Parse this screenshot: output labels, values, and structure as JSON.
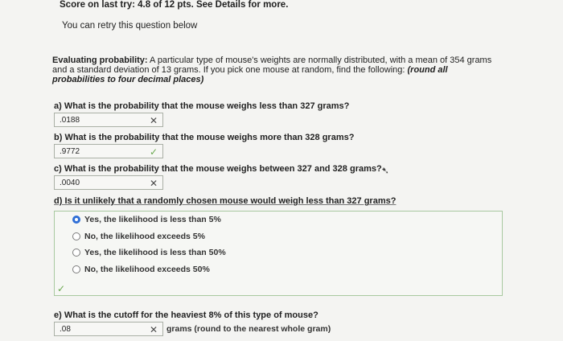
{
  "header": {
    "score_line": "Score on last try: 4.8 of 12 pts. See Details for more.",
    "retry_line": "You can retry this question below"
  },
  "problem": {
    "label": "Evaluating probability:",
    "text": "A particular type of mouse's weights are normally distributed, with a mean of 354 grams and a standard deviation of 13 grams. If you pick one mouse at random, find the following:",
    "instruction": "(round all probabilities to four decimal places)"
  },
  "questions": {
    "a": {
      "text": "a) What is the probability that the mouse weighs less than 327 grams?",
      "value": ".0188",
      "status": "incorrect"
    },
    "b": {
      "text": "b) What is the probability that the mouse weighs more than 328 grams?",
      "value": ".9772",
      "status": "correct"
    },
    "c": {
      "text": "c) What is the probability that the mouse weighs between 327 and 328 grams?",
      "value": ".0040",
      "status": "incorrect"
    },
    "d": {
      "text": "d) Is it unlikely that a randomly chosen mouse would weigh less than 327 grams?",
      "options": [
        {
          "label": "Yes, the likelihood is less than 5%",
          "selected": true
        },
        {
          "label": "No, the likelihood exceeds 5%",
          "selected": false
        },
        {
          "label": "Yes, the likelihood is less than 50%",
          "selected": false
        },
        {
          "label": "No, the likelihood exceeds 50%",
          "selected": false
        }
      ],
      "status": "correct"
    },
    "e": {
      "text": "e) What is the cutoff for the heaviest 8% of this type of mouse?",
      "value": ".08",
      "status": "incorrect",
      "suffix": "grams (round to the nearest whole gram)"
    }
  },
  "icons": {
    "incorrect": "x-icon",
    "correct": "check-icon"
  },
  "colors": {
    "correct": "#6aa84f",
    "incorrect": "#4a4a4a",
    "selected_radio": "#2f6fd6"
  }
}
